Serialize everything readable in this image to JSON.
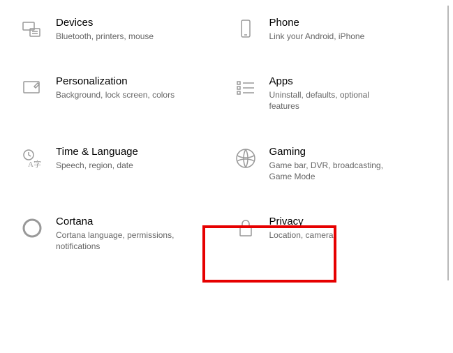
{
  "tiles": [
    {
      "title": "Devices",
      "desc": "Bluetooth, printers, mouse"
    },
    {
      "title": "Phone",
      "desc": "Link your Android, iPhone"
    },
    {
      "title": "Personalization",
      "desc": "Background, lock screen, colors"
    },
    {
      "title": "Apps",
      "desc": "Uninstall, defaults, optional features"
    },
    {
      "title": "Time & Language",
      "desc": "Speech, region, date"
    },
    {
      "title": "Gaming",
      "desc": "Game bar, DVR, broadcasting, Game Mode"
    },
    {
      "title": "Cortana",
      "desc": "Cortana language, permissions, notifications"
    },
    {
      "title": "Privacy",
      "desc": "Location, camera"
    }
  ]
}
